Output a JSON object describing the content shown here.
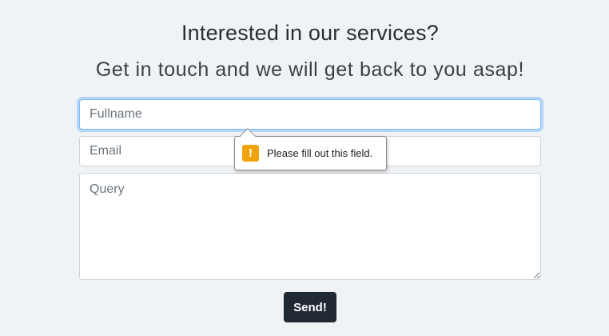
{
  "header": {
    "title": "Interested in our services?",
    "subtitle": "Get in touch and we will get back to you asap!"
  },
  "form": {
    "fullname": {
      "placeholder": "Fullname",
      "value": ""
    },
    "email": {
      "placeholder": "Email",
      "value": ""
    },
    "query": {
      "placeholder": "Query",
      "value": ""
    },
    "send_label": "Send!"
  },
  "validation_tooltip": {
    "icon": "warning-icon",
    "icon_glyph": "!",
    "icon_color": "#f0a30a",
    "message": "Please fill out this field."
  },
  "colors": {
    "background": "#f0f3f5",
    "button": "#212a33",
    "focus_ring": "#80bdff"
  }
}
